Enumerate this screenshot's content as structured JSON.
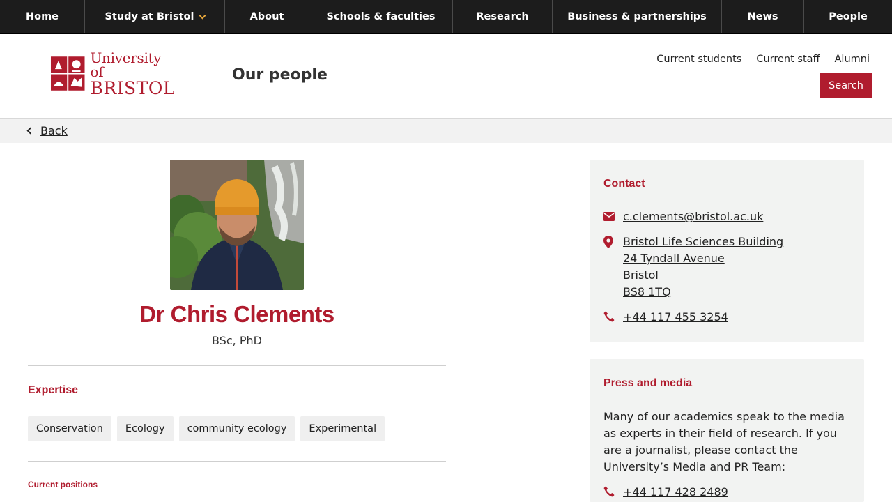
{
  "nav": {
    "items": [
      {
        "label": "Home"
      },
      {
        "label": "Study at Bristol"
      },
      {
        "label": "About"
      },
      {
        "label": "Schools & faculties"
      },
      {
        "label": "Research"
      },
      {
        "label": "Business & partnerships"
      },
      {
        "label": "News"
      },
      {
        "label": "People"
      }
    ]
  },
  "header": {
    "logo_line1": "University of",
    "logo_line2": "BRISTOL",
    "section_title": "Our people",
    "util_links": [
      "Current students",
      "Current staff",
      "Alumni"
    ],
    "search_placeholder": "",
    "search_button": "Search"
  },
  "backbar": {
    "back_label": "Back"
  },
  "profile": {
    "name": "Dr Chris Clements",
    "qualifications": "BSc, PhD",
    "expertise_heading": "Expertise",
    "expertise_tags": [
      "Conservation",
      "Ecology",
      "community ecology",
      "Experimental"
    ],
    "current_positions_heading": "Current positions"
  },
  "contact": {
    "heading": "Contact",
    "email": "c.clements@bristol.ac.uk",
    "address": [
      "Bristol Life Sciences Building",
      "24 Tyndall Avenue",
      "Bristol",
      "BS8 1TQ"
    ],
    "phone": "+44 117 455 3254"
  },
  "press": {
    "heading": "Press and media",
    "text": "Many of our academics speak to the media as experts in their field of research. If you are a journalist, please contact the University’s Media and PR Team:",
    "phone": "+44 117 428 2489"
  },
  "colors": {
    "brand_red": "#b01c2e",
    "nav_bg": "#1c1c1c",
    "chevron_gold": "#e2a33b",
    "panel_bg": "#f2f3f2"
  }
}
